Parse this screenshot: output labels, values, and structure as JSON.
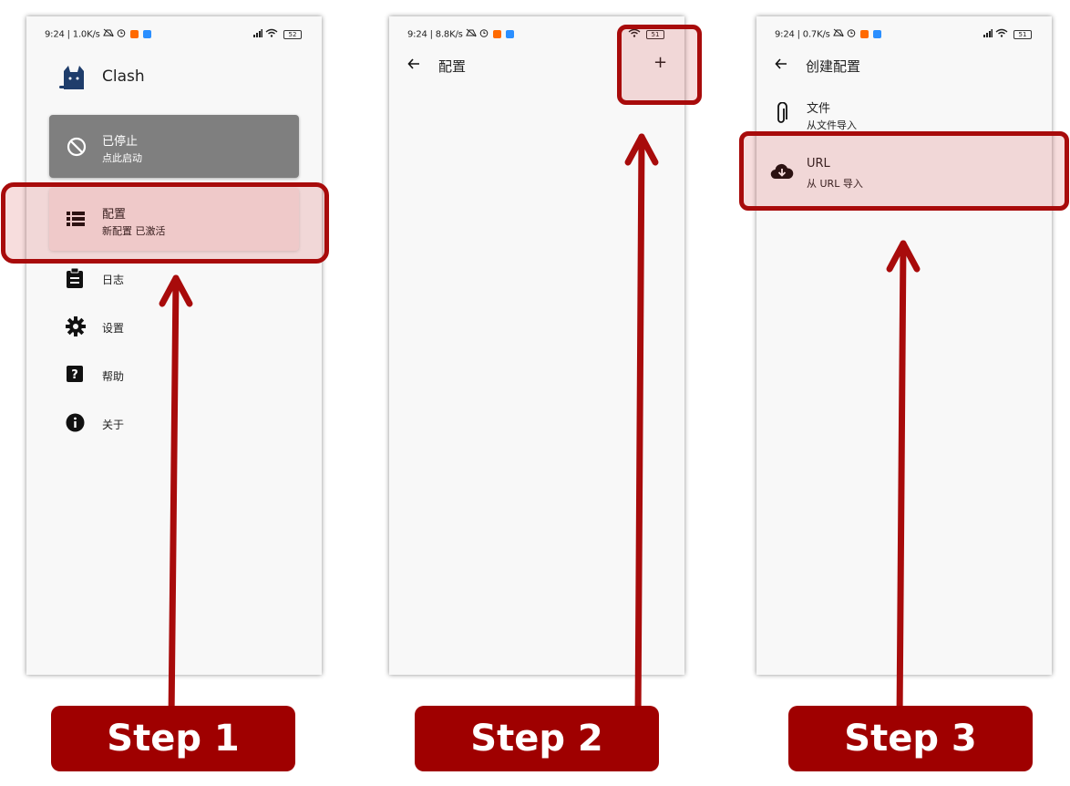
{
  "colors": {
    "highlight": "#a80b0b",
    "step_bg": "#9f0000",
    "phone_bg": "#f8f8f8"
  },
  "phone1": {
    "status": {
      "time": "9:24 | 1.0K/s",
      "battery": "52"
    },
    "app_title": "Clash",
    "stopped_card": {
      "title": "已停止",
      "subtitle": "点此启动",
      "icon": "block-icon"
    },
    "config_card": {
      "title": "配置",
      "subtitle": "新配置 已激活",
      "icon": "list-icon"
    },
    "menu": [
      {
        "label": "日志",
        "icon": "clipboard-icon"
      },
      {
        "label": "设置",
        "icon": "gear-icon"
      },
      {
        "label": "帮助",
        "icon": "help-icon"
      },
      {
        "label": "关于",
        "icon": "info-icon"
      }
    ]
  },
  "phone2": {
    "status": {
      "time": "9:24 | 8.8K/s",
      "battery": "51"
    },
    "title": "配置",
    "add_label": "+"
  },
  "phone3": {
    "status": {
      "time": "9:24 | 0.7K/s",
      "battery": "51"
    },
    "title": "创建配置",
    "options": [
      {
        "title": "文件",
        "subtitle": "从文件导入",
        "icon": "paperclip-icon"
      },
      {
        "title": "URL",
        "subtitle": "从 URL 导入",
        "icon": "cloud-download-icon"
      }
    ]
  },
  "steps": [
    "Step 1",
    "Step 2",
    "Step 3"
  ]
}
